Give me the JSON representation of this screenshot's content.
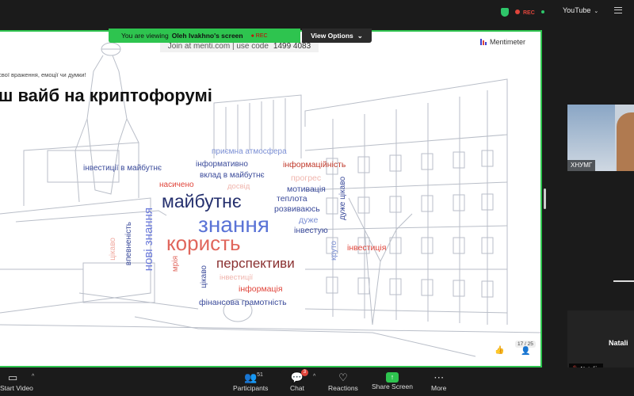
{
  "topbar": {
    "rec_label": "REC",
    "youtube_label": "YouTube"
  },
  "share_banner": {
    "viewing_prefix": "You are viewing",
    "presenter": "Oleh Ivakhno's screen",
    "rec_label": "REC",
    "view_options_label": "View Options"
  },
  "slide": {
    "join_text": "Join at menti.com | use code",
    "join_code": "1499 4083",
    "brand": "Mentimeter",
    "subtitle": "свої враження, емоції чи думки!",
    "title": "ш вайб на криптофорумі",
    "page_indicator": "17 / 25",
    "words": [
      {
        "text": "приємна атмосфера",
        "color": "#7b8fd4"
      },
      {
        "text": "інформативно",
        "color": "#3a4a9a"
      },
      {
        "text": "інформаційність",
        "color": "#c0392b"
      },
      {
        "text": "інвестиції в майбутнє",
        "color": "#3a4a9a"
      },
      {
        "text": "вклад в майбутнє",
        "color": "#3a4a9a"
      },
      {
        "text": "прогрес",
        "color": "#f0b5ad"
      },
      {
        "text": "насичено",
        "color": "#e0453b"
      },
      {
        "text": "досвід",
        "color": "#f0b5ad"
      },
      {
        "text": "мотивація",
        "color": "#3a4a9a"
      },
      {
        "text": "майбутнє",
        "color": "#25306e"
      },
      {
        "text": "теплота",
        "color": "#3a4a9a"
      },
      {
        "text": "дуже цікаво",
        "color": "#3a4a9a"
      },
      {
        "text": "розвиваюсь",
        "color": "#3a4a9a"
      },
      {
        "text": "знання",
        "color": "#5a73d6"
      },
      {
        "text": "дуже",
        "color": "#7b8fd4"
      },
      {
        "text": "інвестую",
        "color": "#3a4a9a"
      },
      {
        "text": "нові знання",
        "color": "#6c7bdb"
      },
      {
        "text": "користь",
        "color": "#e0665c"
      },
      {
        "text": "впевненість",
        "color": "#3a4a9a"
      },
      {
        "text": "цікаво",
        "color": "#f0a99f"
      },
      {
        "text": "круто",
        "color": "#7b8fd4"
      },
      {
        "text": "інвестиція",
        "color": "#e0453b"
      },
      {
        "text": "мрія",
        "color": "#e0665c"
      },
      {
        "text": "цікаво",
        "color": "#3a4a9a"
      },
      {
        "text": "перспективи",
        "color": "#8a3030"
      },
      {
        "text": "інвестиції",
        "color": "#f0b5ad"
      },
      {
        "text": "інформація",
        "color": "#e0453b"
      },
      {
        "text": "фінансова грамотність",
        "color": "#3a4a9a"
      }
    ]
  },
  "participants_panel": {
    "tile1_label": "ХНУМГ",
    "tile2_name": "Natali",
    "tile2_label": "Nataliia"
  },
  "toolbar": {
    "start_video": "Start Video",
    "participants": "Participants",
    "participants_count": "51",
    "chat": "Chat",
    "chat_badge": "3",
    "reactions": "Reactions",
    "share_screen": "Share Screen",
    "more": "More"
  }
}
